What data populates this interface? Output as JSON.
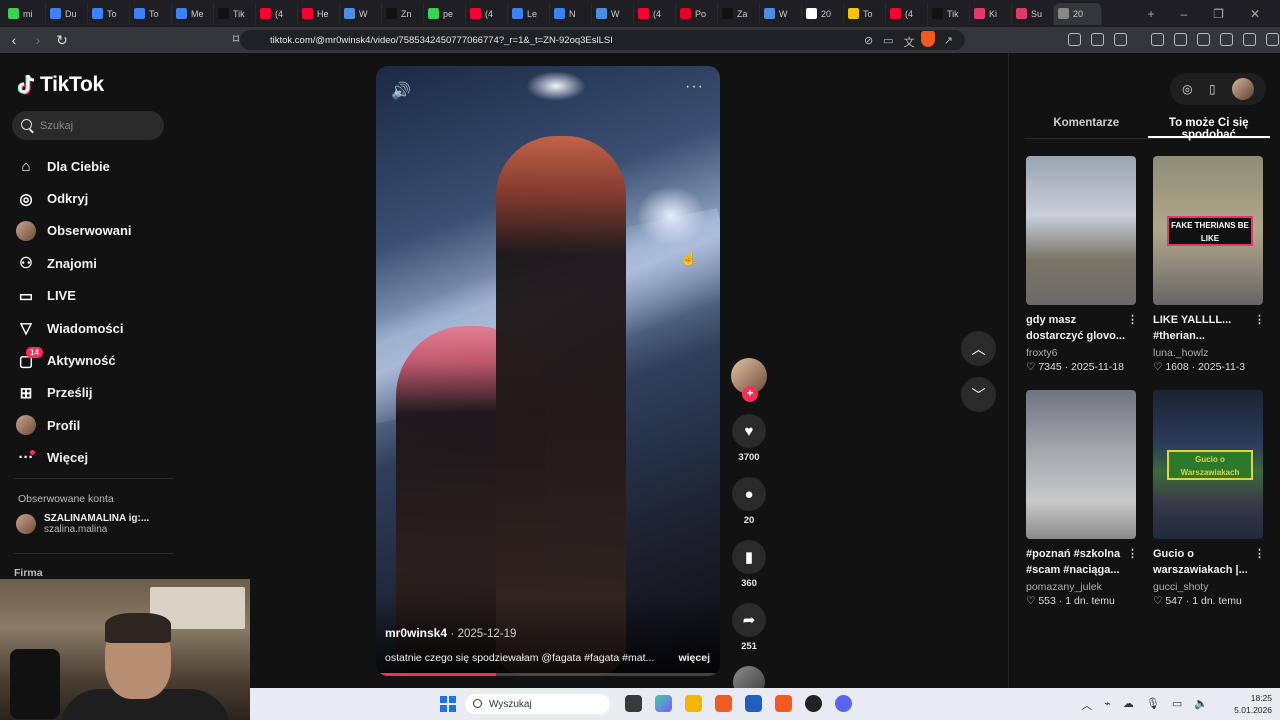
{
  "browser": {
    "tabs": [
      {
        "label": "mi",
        "color": "#39d353"
      },
      {
        "label": "Du",
        "color": "#3b82f6"
      },
      {
        "label": "To",
        "color": "#3b82f6"
      },
      {
        "label": "To",
        "color": "#3b82f6"
      },
      {
        "label": "Me",
        "color": "#3b82f6"
      },
      {
        "label": "Tik",
        "color": "#111111"
      },
      {
        "label": "(4",
        "color": "#ff0033"
      },
      {
        "label": "He",
        "color": "#ff0033"
      },
      {
        "label": "W",
        "color": "#4a90e2"
      },
      {
        "label": "Zn",
        "color": "#111111"
      },
      {
        "label": "pe",
        "color": "#39d353"
      },
      {
        "label": "(4",
        "color": "#ff0033"
      },
      {
        "label": "Le",
        "color": "#3b82f6"
      },
      {
        "label": "N",
        "color": "#3b82f6"
      },
      {
        "label": "W",
        "color": "#4a90e2"
      },
      {
        "label": "(4",
        "color": "#ff0033"
      },
      {
        "label": "Po",
        "color": "#e60023"
      },
      {
        "label": "Za",
        "color": "#111111"
      },
      {
        "label": "W",
        "color": "#4a90e2"
      },
      {
        "label": "20",
        "color": "#ffffff"
      },
      {
        "label": "To",
        "color": "#f7c600"
      },
      {
        "label": "(4",
        "color": "#ff0033"
      },
      {
        "label": "Tik",
        "color": "#111111"
      },
      {
        "label": "Ki",
        "color": "#e2396a"
      },
      {
        "label": "Su",
        "color": "#e2396a"
      },
      {
        "label": "20",
        "color": "#888888"
      }
    ],
    "url": "tiktok.com/@mr0winsk4/video/7585342450777066774?_r=1&_t=ZN-92oq3EslLSI",
    "brave_badge": "1"
  },
  "sidebar": {
    "logo": "TikTok",
    "search_placeholder": "Szukaj",
    "menu": [
      {
        "label": "Dla Ciebie",
        "icon": "home-icon"
      },
      {
        "label": "Odkryj",
        "icon": "compass-icon"
      },
      {
        "label": "Obserwowani",
        "icon": "following-avatar-icon"
      },
      {
        "label": "Znajomi",
        "icon": "friends-icon"
      },
      {
        "label": "LIVE",
        "icon": "live-icon"
      },
      {
        "label": "Wiadomości",
        "icon": "paper-plane-icon"
      },
      {
        "label": "Aktywność",
        "icon": "activity-icon",
        "badge": "14"
      },
      {
        "label": "Prześlij",
        "icon": "upload-icon"
      },
      {
        "label": "Profil",
        "icon": "profile-avatar-icon"
      },
      {
        "label": "Więcej",
        "icon": "more-icon"
      }
    ],
    "followed_title": "Obserwowane konta",
    "followed": {
      "name": "SZALINAMALINA ig:...",
      "handle": "szalina.malina"
    },
    "firma": "Firma"
  },
  "video": {
    "author": "mr0winsk4",
    "date": "2025-12-19",
    "description": "ostatnie czego się spodziewałam @fagata #fagata #mat...",
    "more": "więcej",
    "progress": 0.35
  },
  "actions": {
    "likes": "3700",
    "comments": "20",
    "saves": "360",
    "shares": "251"
  },
  "right_panel": {
    "tabs": [
      "Komentarze",
      "To może Ci się spodobać"
    ],
    "active_tab": 1,
    "cards": [
      {
        "title1": "gdy masz",
        "title2": "dostarczyć glovo...",
        "user": "froxty6",
        "likes": "7345",
        "date": "2025-11-18",
        "overlay": ""
      },
      {
        "title1": "LIKE YALLLL...",
        "title2": "#therian...",
        "user": "luna._howlz",
        "likes": "1608",
        "date": "2025-11-3",
        "overlay": "FAKE THERIANS BE LIKE"
      },
      {
        "title1": "#poznań #szkolna",
        "title2": "#scam #naciąga...",
        "user": "pomazany_julek",
        "likes": "553",
        "date": "1 dn. temu",
        "overlay": ""
      },
      {
        "title1": "Gucio o",
        "title2": "warszawiakach |...",
        "user": "gucci_shoty",
        "likes": "547",
        "date": "1 dn. temu",
        "overlay": "Gucio o Warszawiakach"
      }
    ]
  },
  "taskbar": {
    "search_placeholder": "Wyszukaj",
    "time": "18:25",
    "date": "5.01.2026"
  }
}
